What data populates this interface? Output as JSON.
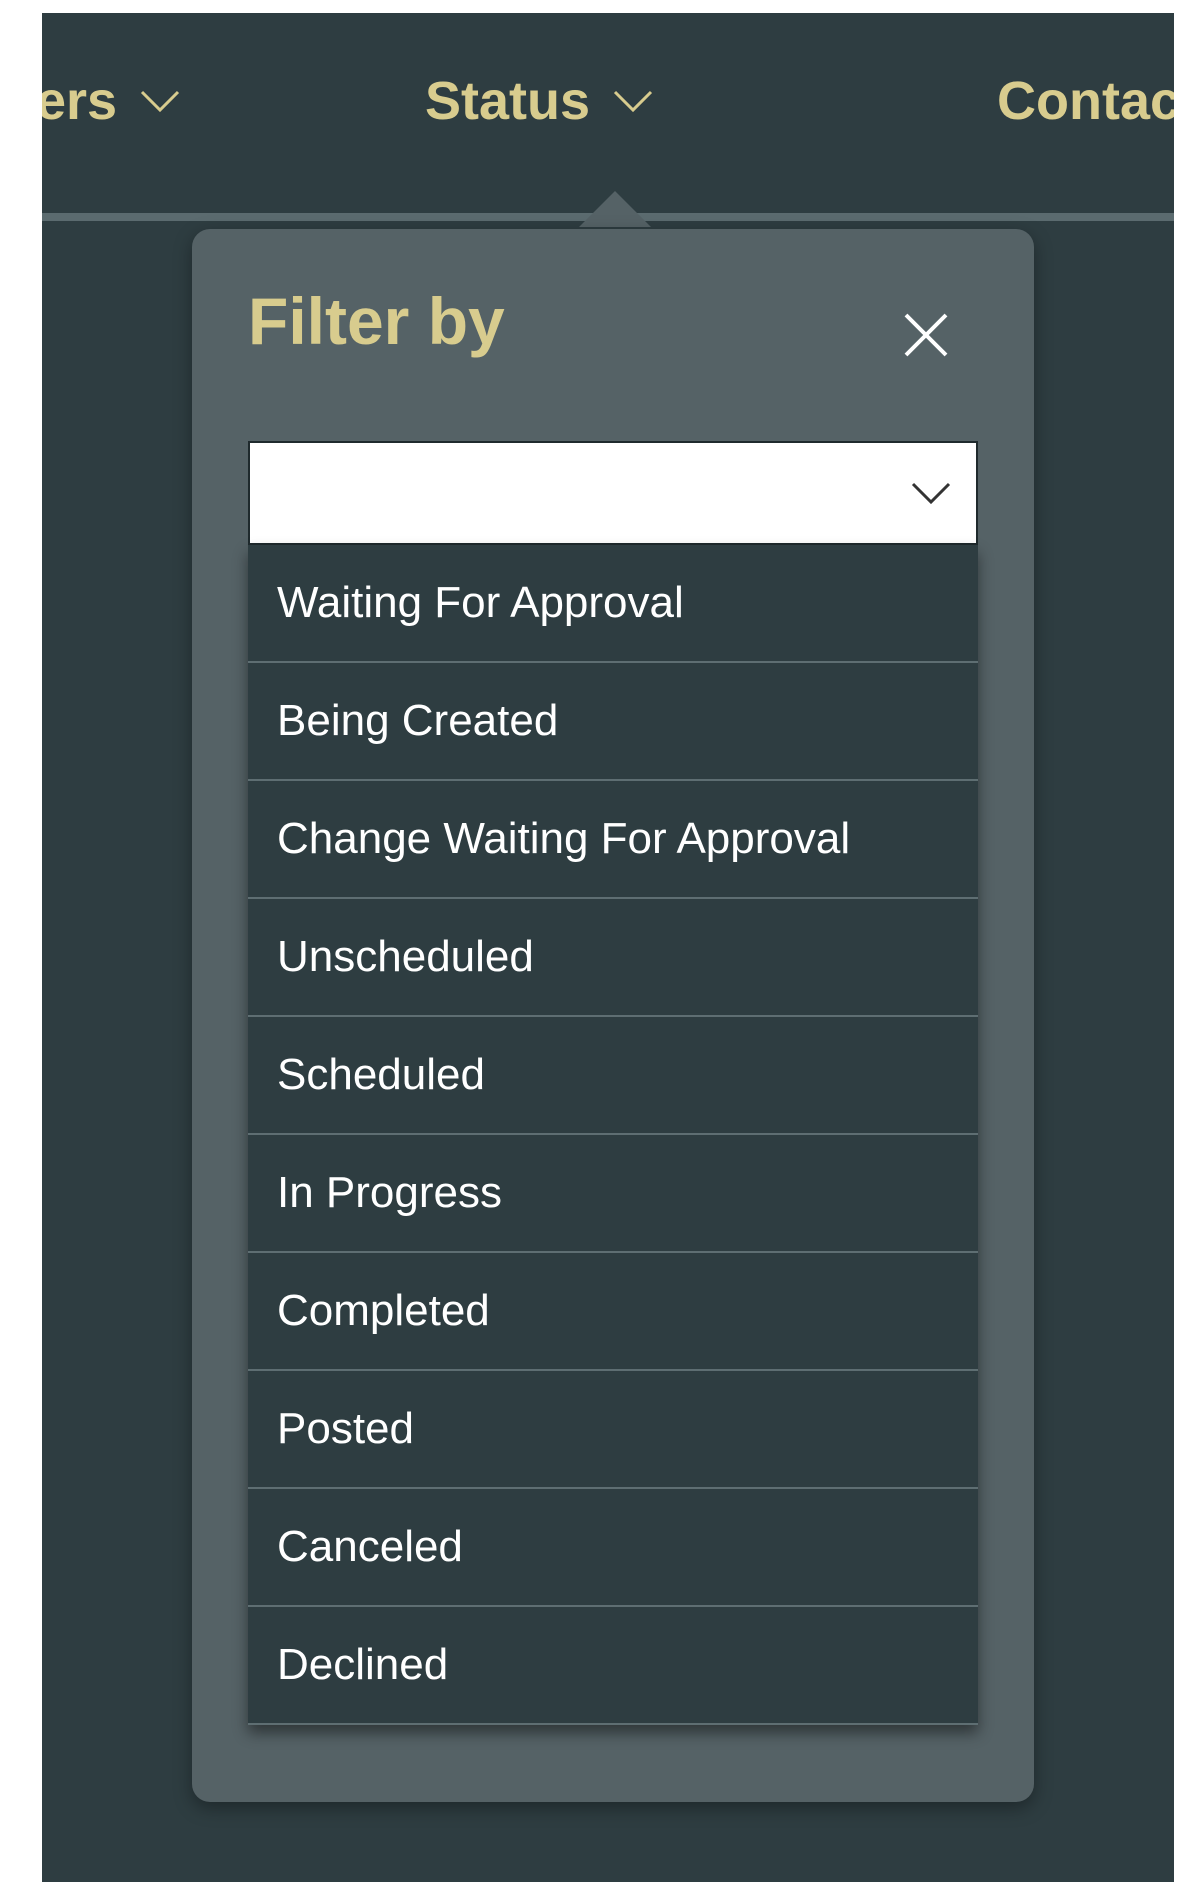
{
  "nav": {
    "items": [
      {
        "label": "ers"
      },
      {
        "label": "Status"
      },
      {
        "label": "Contac"
      }
    ]
  },
  "filter": {
    "title": "Filter by",
    "selected_value": "",
    "options": [
      "Waiting For Approval",
      "Being Created",
      "Change Waiting For Approval",
      "Unscheduled",
      "Scheduled",
      "In Progress",
      "Completed",
      "Posted",
      "Canceled",
      "Declined"
    ]
  },
  "icons": {
    "nav_dropdown": "chevron-down-icon",
    "close": "close-icon",
    "select_dropdown": "chevron-down-icon"
  },
  "colors": {
    "background": "#2e3d41",
    "panel": "#556266",
    "accent_text": "#d8cc8e",
    "option_text": "#ffffff",
    "select_background": "#ffffff"
  }
}
